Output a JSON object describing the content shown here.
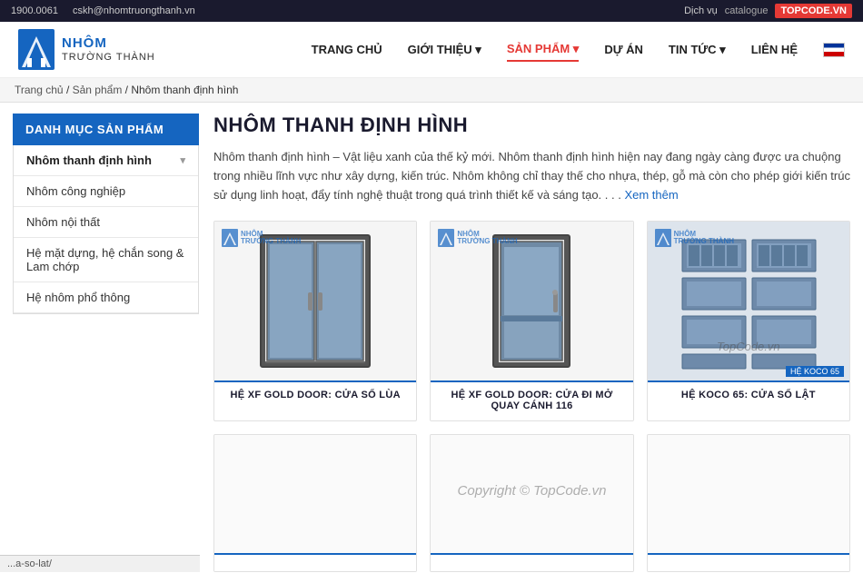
{
  "topbar": {
    "phone": "1900.0061",
    "email": "cskh@nhomtruongthanh.vn",
    "right_label": "Dịch vụ",
    "catalogue_label": "catalogue",
    "topcode_label": "TOPCODE.VN"
  },
  "header": {
    "brand_line1": "NHÔM",
    "brand_line2": "TRƯỜNG THÀNH",
    "nav": [
      {
        "label": "TRANG CHỦ",
        "active": false,
        "has_arrow": false
      },
      {
        "label": "GIỚI THIỆU",
        "active": false,
        "has_arrow": true
      },
      {
        "label": "SẢN PHẨM",
        "active": true,
        "has_arrow": true
      },
      {
        "label": "DỰ ÁN",
        "active": false,
        "has_arrow": false
      },
      {
        "label": "TIN TỨC",
        "active": false,
        "has_arrow": true
      },
      {
        "label": "LIÊN HỆ",
        "active": false,
        "has_arrow": false
      }
    ]
  },
  "breadcrumb": {
    "home": "Trang chủ",
    "parent": "Sản phẩm",
    "current": "Nhôm thanh định hình"
  },
  "sidebar": {
    "title": "DANH MỤC SẢN PHẨM",
    "items": [
      {
        "label": "Nhôm thanh định hình",
        "active": true,
        "has_arrow": true
      },
      {
        "label": "Nhôm công nghiệp",
        "active": false,
        "has_arrow": false
      },
      {
        "label": "Nhôm nội thất",
        "active": false,
        "has_arrow": false
      },
      {
        "label": "Hệ mặt dựng, hệ chắn song & Lam chớp",
        "active": false,
        "has_arrow": false
      },
      {
        "label": "Hệ nhôm phổ thông",
        "active": false,
        "has_arrow": false
      }
    ]
  },
  "content": {
    "title": "NHÔM THANH ĐỊNH HÌNH",
    "description": "Nhôm thanh định hình – Vật liệu xanh của thế kỷ mới. Nhôm thanh định hình hiện nay đang ngày càng được ưa chuộng trong nhiều lĩnh vực như xây dựng, kiến trúc. Nhôm không chỉ thay thế cho nhựa, thép, gỗ mà còn cho phép giới kiến trúc sử dụng linh hoạt, đẩy tính nghệ thuật trong quá trình thiết kế và sáng tạo. . . .",
    "see_more": "Xem thêm",
    "products": [
      {
        "label": "HỆ XF GOLD DOOR: CỬA SỔ LÙA",
        "type": "door-sliding"
      },
      {
        "label": "HỆ XF GOLD DOOR: CỬA ĐI MỞ QUAY CÁNH 116",
        "type": "door-swing"
      },
      {
        "label": "HỆ KOCO 65: CỬA SỔ LẬT",
        "type": "aluminium-section"
      },
      {
        "label": "",
        "type": "empty"
      },
      {
        "label": "",
        "type": "empty"
      },
      {
        "label": "",
        "type": "empty"
      }
    ]
  },
  "url_bar": "...a-so-lat/",
  "topcode_watermark": "TopCode.vn",
  "copyright": "Copyright © TopCode.vn",
  "koco_label": "HỆ KOCO 65"
}
